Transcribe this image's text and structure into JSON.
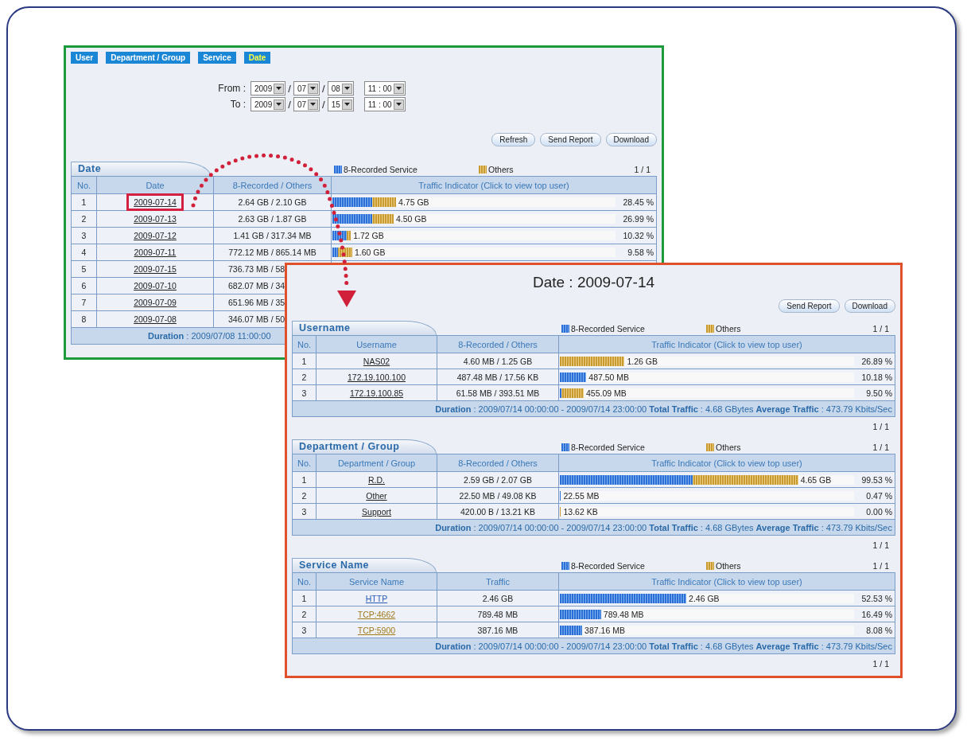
{
  "left_panel": {
    "tabs": [
      {
        "label": "User",
        "selected": false
      },
      {
        "label": "Department / Group",
        "selected": false
      },
      {
        "label": "Service",
        "selected": false
      },
      {
        "label": "Date",
        "selected": true
      }
    ],
    "range": {
      "separator": "/",
      "rows": [
        {
          "label": "From :",
          "fields": [
            "2009",
            "07",
            "08",
            "11 : 00"
          ]
        },
        {
          "label": "To :",
          "fields": [
            "2009",
            "07",
            "15",
            "11 : 00"
          ]
        }
      ]
    },
    "buttons": [
      "Refresh",
      "Send Report",
      "Download"
    ],
    "section": {
      "tab_title": "Date",
      "legend": [
        {
          "kind": "recorded",
          "label": "8-Recorded Service"
        },
        {
          "kind": "others",
          "label": "Others"
        }
      ],
      "page_top": "1 / 1",
      "columns": [
        "No.",
        "Date",
        "8-Recorded / Others",
        "Traffic Indicator (Click to view top user)"
      ],
      "rows": [
        {
          "kind": "full",
          "highlighted": true,
          "no": "1",
          "name": "2009-07-14",
          "recorded": "2.64 GB / 2.10 GB",
          "fills": [
            {
              "kind": "others",
              "level": 0.225
            },
            {
              "kind": "recorded",
              "level": 0.14
            }
          ],
          "total": "4.75 GB",
          "percent": "28.45 %"
        },
        {
          "kind": "full",
          "highlighted": false,
          "no": "2",
          "name": "2009-07-13",
          "recorded": "2.63 GB / 1.87 GB",
          "fills": [
            {
              "kind": "others",
              "level": 0.216
            },
            {
              "kind": "recorded",
              "level": 0.14
            }
          ],
          "total": "4.50 GB",
          "percent": "26.99 %"
        },
        {
          "kind": "full",
          "highlighted": false,
          "no": "3",
          "name": "2009-07-12",
          "recorded": "1.41 GB / 317.34 MB",
          "fills": [
            {
              "kind": "others",
              "level": 0.065
            },
            {
              "kind": "recorded",
              "level": 0.05
            }
          ],
          "total": "1.72 GB",
          "percent": "10.32 %"
        },
        {
          "kind": "full",
          "highlighted": false,
          "no": "4",
          "name": "2009-07-11",
          "recorded": "772.12 MB / 865.14 MB",
          "fills": [
            {
              "kind": "others",
              "level": 0.07
            },
            {
              "kind": "recorded",
              "level": 0.02
            }
          ],
          "total": "1.60 GB",
          "percent": "9.58 %"
        },
        {
          "kind": "covered",
          "highlighted": false,
          "no": "5",
          "name": "2009-07-15",
          "recorded": "736.73 MB / 58"
        },
        {
          "kind": "covered",
          "highlighted": false,
          "no": "6",
          "name": "2009-07-10",
          "recorded": "682.07 MB / 34"
        },
        {
          "kind": "covered",
          "highlighted": false,
          "no": "7",
          "name": "2009-07-09",
          "recorded": "651.96 MB / 35"
        },
        {
          "kind": "covered",
          "highlighted": false,
          "no": "8",
          "name": "2009-07-08",
          "recorded": "346.07 MB / 50"
        }
      ],
      "footer": "**Duration** : 2009/07/08 11:00:00"
    }
  },
  "report": {
    "title": "Date : 2009-07-14",
    "buttons": [
      "Send Report",
      "Download"
    ],
    "sections": [
      {
        "tab_title": "Username",
        "legend": [
          {
            "kind": "recorded",
            "label": "8-Recorded Service"
          },
          {
            "kind": "others",
            "label": "Others"
          }
        ],
        "page_top": "1 / 1",
        "columns": [
          "No.",
          "Username",
          "8-Recorded / Others",
          "Traffic Indicator (Click to view top user)"
        ],
        "rows": [
          {
            "no": "1",
            "name": "NAS02",
            "recorded": "4.60 MB / 1.25 GB",
            "fills": [
              {
                "kind": "others",
                "level": 0.22
              }
            ],
            "total": "1.26 GB",
            "percent": "26.89 %"
          },
          {
            "no": "2",
            "name": "172.19.100.100",
            "recorded": "487.48 MB / 17.56 KB",
            "fills": [
              {
                "kind": "recorded",
                "level": 0.09
              }
            ],
            "total": "487.50 MB",
            "percent": "10.18 %"
          },
          {
            "no": "3",
            "name": "172.19.100.85",
            "recorded": "61.58 MB / 393.51 MB",
            "fills": [
              {
                "kind": "others",
                "level": 0.081
              },
              {
                "kind": "recorded",
                "level": 0.006
              }
            ],
            "total": "455.09 MB",
            "percent": "9.50 %"
          }
        ],
        "footer": "**Duration** : 2009/07/14 00:00:00 - 2009/07/14 23:00:00  **Total Traffic** : 4.68 GBytes  **Average Traffic** : 473.79 Kbits/Sec",
        "page_bottom": "1 / 1"
      },
      {
        "tab_title": "Department / Group",
        "legend": [
          {
            "kind": "recorded",
            "label": "8-Recorded Service"
          },
          {
            "kind": "others",
            "label": "Others"
          }
        ],
        "page_top": "1 / 1",
        "columns": [
          "No.",
          "Department / Group",
          "8-Recorded / Others",
          "Traffic Indicator (Click to view top user)"
        ],
        "rows": [
          {
            "no": "1",
            "name": "R.D.",
            "recorded": "2.59 GB / 2.07 GB",
            "fills": [
              {
                "kind": "others",
                "level": 0.81
              },
              {
                "kind": "recorded",
                "level": 0.45
              }
            ],
            "total": "4.65 GB",
            "percent": "99.53 %"
          },
          {
            "no": "2",
            "name": "Other",
            "recorded": "22.50 MB / 49.08 KB",
            "fills": [
              {
                "kind": "recorded",
                "level": 0.004
              }
            ],
            "total": "22.55 MB",
            "percent": "0.47 %"
          },
          {
            "no": "3",
            "name": "Support",
            "recorded": "420.00 B / 13.21 KB",
            "fills": [
              {
                "kind": "others",
                "level": 0.004
              }
            ],
            "total": "13.62 KB",
            "percent": "0.00 %"
          }
        ],
        "footer": "**Duration** : 2009/07/14 00:00:00 - 2009/07/14 23:00:00  **Total Traffic** : 4.68 GBytes  **Average Traffic** : 473.79 Kbits/Sec",
        "page_bottom": "1 / 1"
      },
      {
        "tab_title": "Service Name",
        "legend": [
          {
            "kind": "recorded",
            "label": "8-Recorded Service"
          },
          {
            "kind": "others",
            "label": "Others"
          }
        ],
        "page_top": "1 / 1",
        "columns": [
          "No.",
          "Service Name",
          "Traffic",
          "Traffic Indicator (Click to view top user)"
        ],
        "rows": [
          {
            "no": "1",
            "name": "HTTP",
            "color": "#2a5ab8",
            "recorded": "2.46 GB",
            "fills": [
              {
                "kind": "recorded",
                "level": 0.43
              }
            ],
            "total": "2.46 GB",
            "percent": "52.53 %"
          },
          {
            "no": "2",
            "name": "TCP:4662",
            "color": "#a07818",
            "recorded": "789.48 MB",
            "fills": [
              {
                "kind": "recorded",
                "level": 0.14
              }
            ],
            "total": "789.48 MB",
            "percent": "16.49 %"
          },
          {
            "no": "3",
            "name": "TCP:5900",
            "color": "#a07818",
            "recorded": "387.16 MB",
            "fills": [
              {
                "kind": "recorded",
                "level": 0.076
              }
            ],
            "total": "387.16 MB",
            "percent": "8.08 %"
          }
        ],
        "footer": "**Duration** : 2009/07/14 00:00:00 - 2009/07/14 23:00:00  **Total Traffic** : 4.68 GBytes  **Average Traffic** : 473.79 Kbits/Sec",
        "page_bottom": "1 / 1"
      }
    ]
  }
}
